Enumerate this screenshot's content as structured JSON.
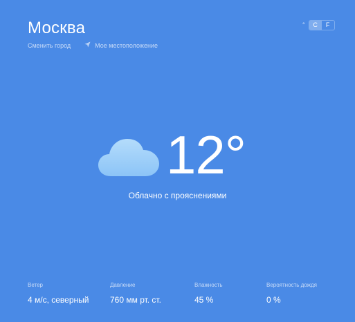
{
  "header": {
    "city": "Москва",
    "change_city": "Сменить город",
    "my_location": "Мое местоположение"
  },
  "units": {
    "degree_symbol": "°",
    "celsius": "C",
    "fahrenheit": "F",
    "selected": "C"
  },
  "current": {
    "icon": "cloud-icon",
    "temperature": "12°",
    "description": "Облачно с прояснениями"
  },
  "stats": [
    {
      "label": "Ветер",
      "value": "4 м/с, северный"
    },
    {
      "label": "Давление",
      "value": "760 мм рт. ст."
    },
    {
      "label": "Влажность",
      "value": "45 %"
    },
    {
      "label": "Вероятность дождя",
      "value": "0 %"
    }
  ],
  "colors": {
    "background": "#4a8ae6",
    "text": "#ffffff",
    "muted_text": "#c9dcf8",
    "toggle_active": "#7fadee",
    "cloud_top": "#b4dcfb",
    "cloud_bottom": "#8cc4f7"
  }
}
